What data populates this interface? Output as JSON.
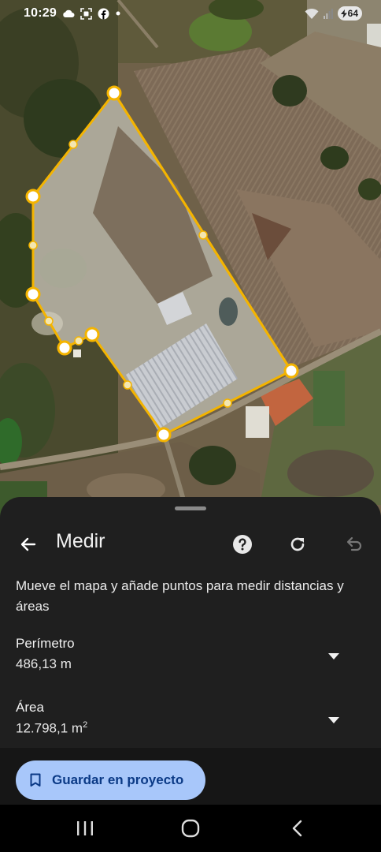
{
  "status_bar": {
    "time": "10:29",
    "left_icons": [
      "cloud-icon",
      "screenshot-icon",
      "facebook-icon",
      "dot-icon"
    ],
    "right_icons": [
      "wifi-icon",
      "signal-icon"
    ],
    "battery_level": "64"
  },
  "map": {
    "type": "satellite",
    "polygon_color": "#f4b400",
    "vertex_count": 8
  },
  "sheet": {
    "title": "Medir",
    "toolbar_icons": [
      "back-arrow-icon",
      "help-icon",
      "refresh-icon",
      "undo-icon"
    ],
    "instructions": "Mueve el mapa y añade puntos para medir distancias y áreas",
    "perimeter": {
      "label": "Perímetro",
      "value": "486,13 m"
    },
    "area": {
      "label": "Área",
      "value": "12.798,1 m",
      "unit_superscript": "2"
    },
    "save_button": {
      "label": "Guardar en proyecto",
      "icon": "bookmark-icon"
    }
  },
  "nav_bar": {
    "buttons": [
      "recent-apps-icon",
      "home-icon",
      "back-icon"
    ]
  },
  "colors": {
    "accent": "#a8c7fa",
    "sheet_background": "#1f1f1f",
    "polygon": "#f4b400"
  }
}
